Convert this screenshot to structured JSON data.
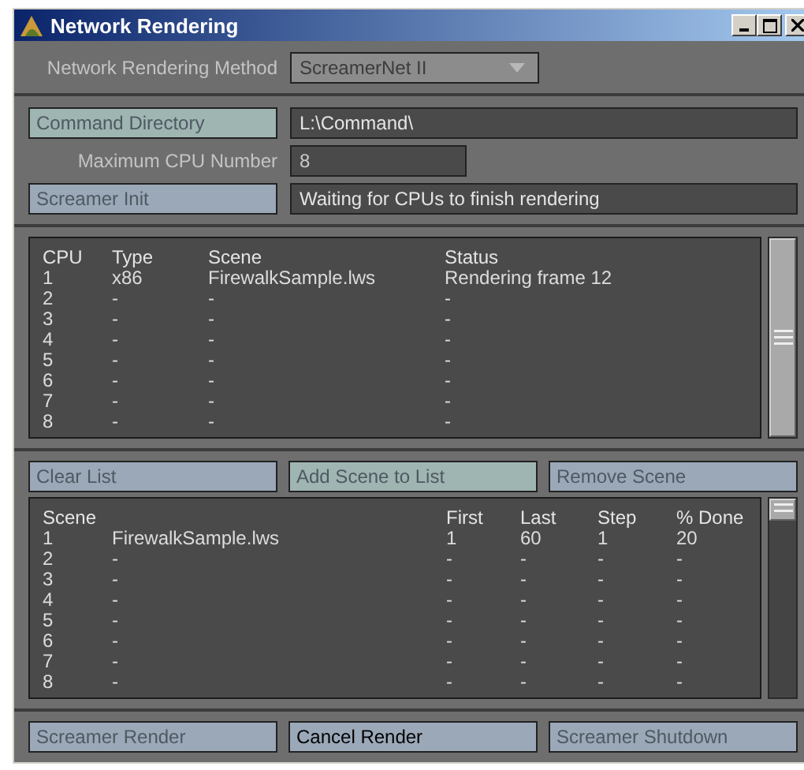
{
  "window": {
    "title": "Network Rendering"
  },
  "method": {
    "label": "Network Rendering Method",
    "value": "ScreamerNet II",
    "disabled": true
  },
  "command_directory": {
    "button": {
      "label": "Command Directory",
      "disabled": true,
      "color": "#9fb5b2"
    },
    "value": "L:\\Command\\"
  },
  "max_cpu": {
    "label": "Maximum CPU Number",
    "value": "8",
    "disabled": true
  },
  "screamer_init": {
    "button": {
      "label": "Screamer Init",
      "disabled": true,
      "color": "#9aa8b8"
    },
    "value": "Waiting for CPUs to finish rendering"
  },
  "cpu_table": {
    "columns": [
      "CPU",
      "Type",
      "Scene",
      "Status"
    ],
    "rows": [
      [
        "1",
        "x86",
        "FirewalkSample.lws",
        "Rendering frame 12"
      ],
      [
        "2",
        "-",
        "-",
        "-"
      ],
      [
        "3",
        "-",
        "-",
        "-"
      ],
      [
        "4",
        "-",
        "-",
        "-"
      ],
      [
        "5",
        "-",
        "-",
        "-"
      ],
      [
        "6",
        "-",
        "-",
        "-"
      ],
      [
        "7",
        "-",
        "-",
        "-"
      ],
      [
        "8",
        "-",
        "-",
        "-"
      ]
    ]
  },
  "list_buttons": [
    {
      "label": "Clear List",
      "disabled": true,
      "color": "#9aa8b8"
    },
    {
      "label": "Add Scene to List",
      "disabled": true,
      "color": "#9fb5b2"
    },
    {
      "label": "Remove Scene",
      "disabled": true,
      "color": "#9aa8b8"
    }
  ],
  "scene_table": {
    "columns": [
      "Scene",
      "",
      "First",
      "Last",
      "Step",
      "% Done"
    ],
    "rows": [
      [
        "1",
        "FirewalkSample.lws",
        "1",
        "60",
        "1",
        "20"
      ],
      [
        "2",
        "-",
        "-",
        "-",
        "-",
        "-"
      ],
      [
        "3",
        "-",
        "-",
        "-",
        "-",
        "-"
      ],
      [
        "4",
        "-",
        "-",
        "-",
        "-",
        "-"
      ],
      [
        "5",
        "-",
        "-",
        "-",
        "-",
        "-"
      ],
      [
        "6",
        "-",
        "-",
        "-",
        "-",
        "-"
      ],
      [
        "7",
        "-",
        "-",
        "-",
        "-",
        "-"
      ],
      [
        "8",
        "-",
        "-",
        "-",
        "-",
        "-"
      ]
    ]
  },
  "render_buttons": [
    {
      "label": "Screamer Render",
      "disabled": true,
      "color": "#9aa8b8"
    },
    {
      "label": "Cancel Render",
      "disabled": false,
      "color": "#9aa8b8"
    },
    {
      "label": "Screamer Shutdown",
      "disabled": true,
      "color": "#9aa8b8"
    }
  ]
}
